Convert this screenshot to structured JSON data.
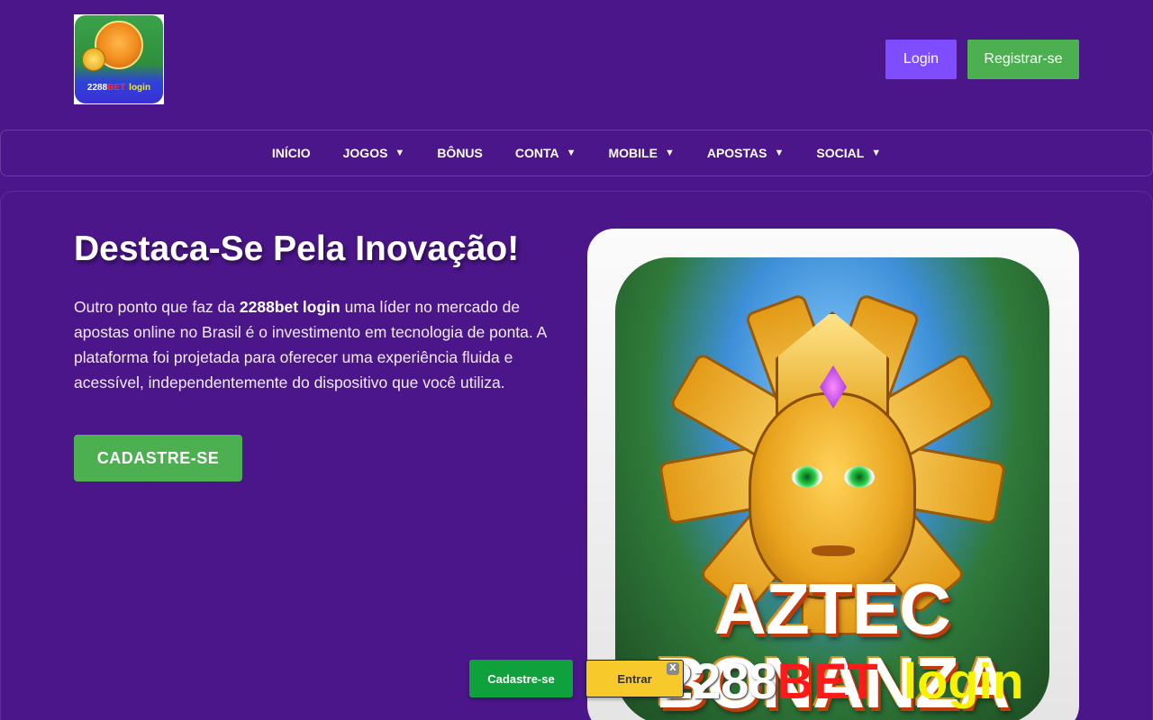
{
  "header": {
    "logo": {
      "text_a": "2288",
      "text_b": "BET",
      "text_c": "login"
    },
    "login_label": "Login",
    "register_label": "Registrar-se"
  },
  "nav": {
    "items": [
      {
        "label": "INÍCIO",
        "caret": ""
      },
      {
        "label": "JOGOS",
        "caret": "▼"
      },
      {
        "label": "BÔNUS",
        "caret": ""
      },
      {
        "label": "CONTA",
        "caret": "▼"
      },
      {
        "label": "MOBILE",
        "caret": "▼"
      },
      {
        "label": "APOSTAS",
        "caret": "▼"
      },
      {
        "label": "SOCIAL",
        "caret": "▼"
      }
    ]
  },
  "hero": {
    "title": "Destaca-Se Pela Inovação!",
    "text_before": "Outro ponto que faz da ",
    "text_strong": "2288bet login",
    "text_after": " uma líder no mercado de apostas online no Brasil é o investimento em tecnologia de ponta. A plataforma foi projetada para oferecer uma experiência fluida e acessível, independentemente do dispositivo que você utiliza.",
    "cta_label": "CADASTRE-SE"
  },
  "game_image": {
    "title_line1": "AZTEC",
    "title_line2": "BONANZA",
    "watermark_a": "2288",
    "watermark_b": "BET",
    "watermark_c": "login"
  },
  "floating": {
    "cadastre_label": "Cadastre-se",
    "entrar_label": "Entrar",
    "close_label": "X"
  },
  "colors": {
    "background": "#4b1689",
    "login_button": "#7d4dff",
    "register_button": "#4caf50",
    "float_entrar": "#f8c92a"
  }
}
